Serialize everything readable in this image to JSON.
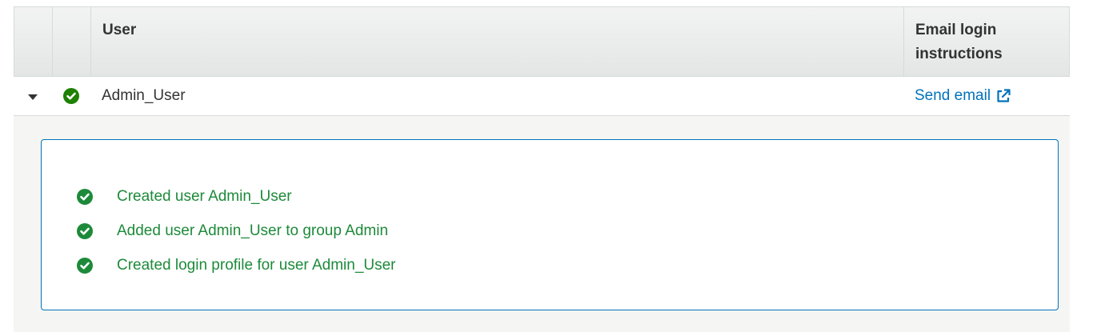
{
  "table": {
    "columns": {
      "user": "User",
      "email_instructions": "Email login instructions"
    },
    "rows": [
      {
        "expanded": true,
        "status_icon": "check-circle-icon",
        "user": "Admin_User",
        "email_link": "Send email",
        "email_icon": "external-link-icon"
      }
    ]
  },
  "details": {
    "messages": [
      "Created user Admin_User",
      "Added user Admin_User to group Admin",
      "Created login profile for user Admin_User"
    ]
  },
  "colors": {
    "success_green": "#1d8102",
    "link_blue": "#0073bb",
    "header_bg": "#eaeded"
  }
}
